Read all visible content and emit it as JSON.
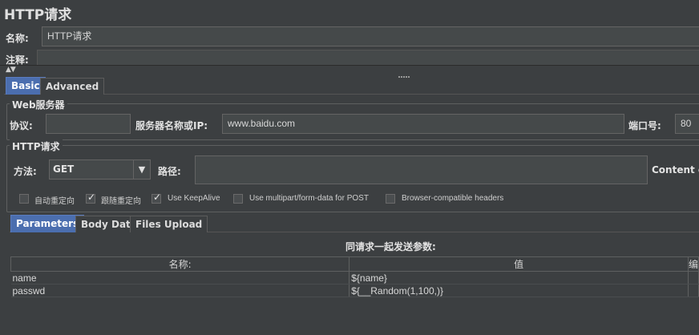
{
  "window": {
    "title": "HTTP请求"
  },
  "name_field": {
    "label": "名称:",
    "value": "HTTP请求"
  },
  "comment_field": {
    "label": "注释:",
    "value": ""
  },
  "config_tabs": [
    {
      "label": "Basic",
      "active": true
    },
    {
      "label": "Advanced",
      "active": false
    }
  ],
  "web_server": {
    "group_title": "Web服务器",
    "protocol_label": "协议:",
    "protocol_value": "",
    "server_label": "服务器名称或IP:",
    "server_value": "www.baidu.com",
    "port_label": "端口号:",
    "port_value": "80"
  },
  "http_request": {
    "group_title": "HTTP请求",
    "method_label": "方法:",
    "method_value": "GET",
    "path_label": "路径:",
    "path_value": "",
    "content_encoding_label": "Content en"
  },
  "checkboxes": [
    {
      "label": "自动重定向",
      "checked": false
    },
    {
      "label": "跟随重定向",
      "checked": true
    },
    {
      "label": "Use KeepAlive",
      "checked": true
    },
    {
      "label": "Use multipart/form-data for POST",
      "checked": false
    },
    {
      "label": "Browser-compatible headers",
      "checked": false
    }
  ],
  "param_tabs": [
    {
      "label": "Parameters",
      "active": true
    },
    {
      "label": "Body Data",
      "active": false
    },
    {
      "label": "Files Upload",
      "active": false
    }
  ],
  "params_table": {
    "caption": "同请求一起发送参数:",
    "headers": [
      "名称:",
      "值",
      "编"
    ],
    "rows": [
      {
        "name": "name",
        "value": "${name}"
      },
      {
        "name": "passwd",
        "value": "${__Random(1,100,)}"
      }
    ]
  },
  "colors": {
    "background": "#3c3f41",
    "active_tab": "#4b6eaf",
    "field_bg": "#45494a"
  }
}
